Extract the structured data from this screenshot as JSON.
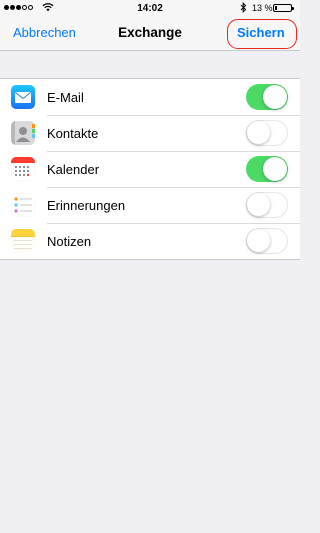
{
  "status_bar": {
    "time": "14:02",
    "battery_percent_text": "13 %",
    "battery_level": 0.13,
    "signal_bars_filled": 3,
    "signal_bars_total": 5
  },
  "nav": {
    "cancel_label": "Abbrechen",
    "title": "Exchange",
    "save_label": "Sichern",
    "accent_color": "#007aff",
    "highlight_color": "#e8261a"
  },
  "accounts": {
    "items": [
      {
        "label": "E-Mail",
        "icon": "mail-icon",
        "enabled": true
      },
      {
        "label": "Kontakte",
        "icon": "contacts-icon",
        "enabled": false
      },
      {
        "label": "Kalender",
        "icon": "calendar-icon",
        "enabled": true
      },
      {
        "label": "Erinnerungen",
        "icon": "reminders-icon",
        "enabled": false
      },
      {
        "label": "Notizen",
        "icon": "notes-icon",
        "enabled": false
      }
    ],
    "switch_on_color": "#4cd964"
  }
}
